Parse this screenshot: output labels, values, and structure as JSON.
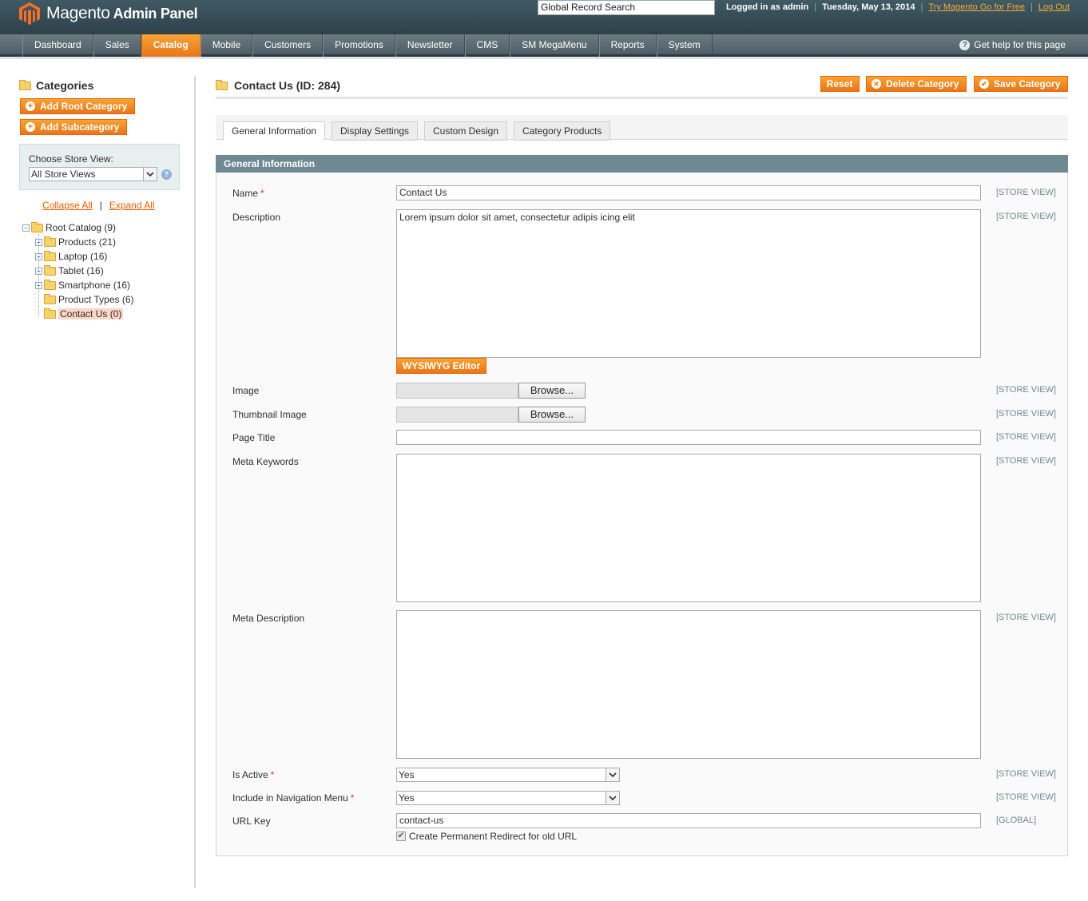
{
  "header": {
    "logo_text": "Magento",
    "logo_sub": "Admin Panel",
    "search_value": "Global Record Search",
    "logged_in": "Logged in as admin",
    "date": "Tuesday, May 13, 2014",
    "try_link": "Try Magento Go for Free",
    "logout": "Log Out"
  },
  "nav": {
    "items": [
      "Dashboard",
      "Sales",
      "Catalog",
      "Mobile",
      "Customers",
      "Promotions",
      "Newsletter",
      "CMS",
      "SM MegaMenu",
      "Reports",
      "System"
    ],
    "active": "Catalog",
    "help": "Get help for this page"
  },
  "sidebar": {
    "title": "Categories",
    "add_root": "Add Root Category",
    "add_sub": "Add Subcategory",
    "store_label": "Choose Store View:",
    "store_value": "All Store Views",
    "collapse_all": "Collapse All",
    "separator": "|",
    "expand_all": "Expand All",
    "tree": [
      {
        "label": "Root Catalog (9)"
      },
      {
        "label": "Products (21)"
      },
      {
        "label": "Laptop (16)"
      },
      {
        "label": "Tablet (16)"
      },
      {
        "label": "Smartphone (16)"
      },
      {
        "label": "Product Types (6)"
      },
      {
        "label": "Contact Us (0)"
      }
    ]
  },
  "main": {
    "title": "Contact Us (ID: 284)",
    "buttons": {
      "reset": "Reset",
      "delete": "Delete Category",
      "save": "Save Category"
    },
    "tabs": [
      "General Information",
      "Display Settings",
      "Custom Design",
      "Category Products"
    ],
    "section_title": "General Information",
    "fields": {
      "name": {
        "label": "Name",
        "value": "Contact Us",
        "scope": "[STORE VIEW]"
      },
      "description": {
        "label": "Description",
        "value": "Lorem ipsum dolor sit amet, consectetur adipis icing elit",
        "scope": "[STORE VIEW]"
      },
      "wysiwyg": "WYSIWYG Editor",
      "image": {
        "label": "Image",
        "button": "Browse...",
        "scope": "[STORE VIEW]"
      },
      "thumbnail": {
        "label": "Thumbnail Image",
        "button": "Browse...",
        "scope": "[STORE VIEW]"
      },
      "page_title": {
        "label": "Page Title",
        "value": "",
        "scope": "[STORE VIEW]"
      },
      "meta_keywords": {
        "label": "Meta Keywords",
        "value": "",
        "scope": "[STORE VIEW]"
      },
      "meta_description": {
        "label": "Meta Description",
        "value": "",
        "scope": "[STORE VIEW]"
      },
      "is_active": {
        "label": "Is Active",
        "value": "Yes",
        "scope": "[STORE VIEW]"
      },
      "include_nav": {
        "label": "Include in Navigation Menu",
        "value": "Yes",
        "scope": "[STORE VIEW]"
      },
      "url_key": {
        "label": "URL Key",
        "value": "contact-us",
        "scope": "[GLOBAL]"
      },
      "redirect": {
        "label": "Create Permanent Redirect for old URL",
        "checked": true
      }
    },
    "required_mark": "*"
  }
}
